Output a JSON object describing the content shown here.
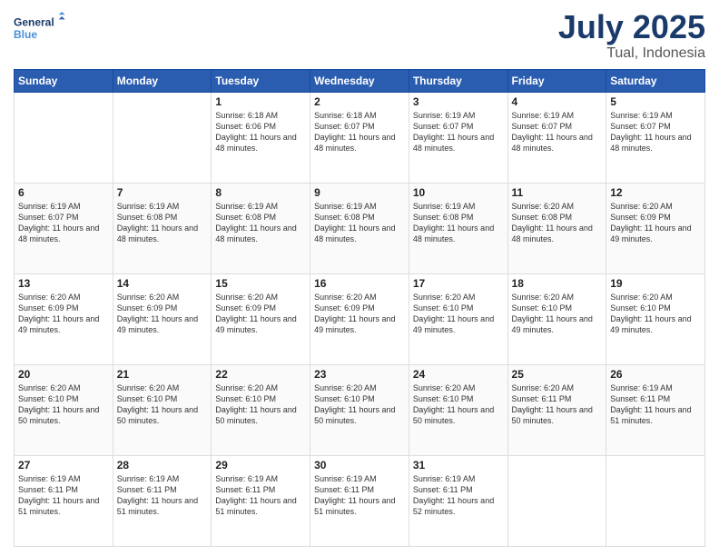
{
  "header": {
    "logo_line1": "General",
    "logo_line2": "Blue",
    "month": "July 2025",
    "location": "Tual, Indonesia"
  },
  "days_of_week": [
    "Sunday",
    "Monday",
    "Tuesday",
    "Wednesday",
    "Thursday",
    "Friday",
    "Saturday"
  ],
  "weeks": [
    [
      {
        "day": "",
        "info": ""
      },
      {
        "day": "",
        "info": ""
      },
      {
        "day": "1",
        "info": "Sunrise: 6:18 AM\nSunset: 6:06 PM\nDaylight: 11 hours and 48 minutes."
      },
      {
        "day": "2",
        "info": "Sunrise: 6:18 AM\nSunset: 6:07 PM\nDaylight: 11 hours and 48 minutes."
      },
      {
        "day": "3",
        "info": "Sunrise: 6:19 AM\nSunset: 6:07 PM\nDaylight: 11 hours and 48 minutes."
      },
      {
        "day": "4",
        "info": "Sunrise: 6:19 AM\nSunset: 6:07 PM\nDaylight: 11 hours and 48 minutes."
      },
      {
        "day": "5",
        "info": "Sunrise: 6:19 AM\nSunset: 6:07 PM\nDaylight: 11 hours and 48 minutes."
      }
    ],
    [
      {
        "day": "6",
        "info": "Sunrise: 6:19 AM\nSunset: 6:07 PM\nDaylight: 11 hours and 48 minutes."
      },
      {
        "day": "7",
        "info": "Sunrise: 6:19 AM\nSunset: 6:08 PM\nDaylight: 11 hours and 48 minutes."
      },
      {
        "day": "8",
        "info": "Sunrise: 6:19 AM\nSunset: 6:08 PM\nDaylight: 11 hours and 48 minutes."
      },
      {
        "day": "9",
        "info": "Sunrise: 6:19 AM\nSunset: 6:08 PM\nDaylight: 11 hours and 48 minutes."
      },
      {
        "day": "10",
        "info": "Sunrise: 6:19 AM\nSunset: 6:08 PM\nDaylight: 11 hours and 48 minutes."
      },
      {
        "day": "11",
        "info": "Sunrise: 6:20 AM\nSunset: 6:08 PM\nDaylight: 11 hours and 48 minutes."
      },
      {
        "day": "12",
        "info": "Sunrise: 6:20 AM\nSunset: 6:09 PM\nDaylight: 11 hours and 49 minutes."
      }
    ],
    [
      {
        "day": "13",
        "info": "Sunrise: 6:20 AM\nSunset: 6:09 PM\nDaylight: 11 hours and 49 minutes."
      },
      {
        "day": "14",
        "info": "Sunrise: 6:20 AM\nSunset: 6:09 PM\nDaylight: 11 hours and 49 minutes."
      },
      {
        "day": "15",
        "info": "Sunrise: 6:20 AM\nSunset: 6:09 PM\nDaylight: 11 hours and 49 minutes."
      },
      {
        "day": "16",
        "info": "Sunrise: 6:20 AM\nSunset: 6:09 PM\nDaylight: 11 hours and 49 minutes."
      },
      {
        "day": "17",
        "info": "Sunrise: 6:20 AM\nSunset: 6:10 PM\nDaylight: 11 hours and 49 minutes."
      },
      {
        "day": "18",
        "info": "Sunrise: 6:20 AM\nSunset: 6:10 PM\nDaylight: 11 hours and 49 minutes."
      },
      {
        "day": "19",
        "info": "Sunrise: 6:20 AM\nSunset: 6:10 PM\nDaylight: 11 hours and 49 minutes."
      }
    ],
    [
      {
        "day": "20",
        "info": "Sunrise: 6:20 AM\nSunset: 6:10 PM\nDaylight: 11 hours and 50 minutes."
      },
      {
        "day": "21",
        "info": "Sunrise: 6:20 AM\nSunset: 6:10 PM\nDaylight: 11 hours and 50 minutes."
      },
      {
        "day": "22",
        "info": "Sunrise: 6:20 AM\nSunset: 6:10 PM\nDaylight: 11 hours and 50 minutes."
      },
      {
        "day": "23",
        "info": "Sunrise: 6:20 AM\nSunset: 6:10 PM\nDaylight: 11 hours and 50 minutes."
      },
      {
        "day": "24",
        "info": "Sunrise: 6:20 AM\nSunset: 6:10 PM\nDaylight: 11 hours and 50 minutes."
      },
      {
        "day": "25",
        "info": "Sunrise: 6:20 AM\nSunset: 6:11 PM\nDaylight: 11 hours and 50 minutes."
      },
      {
        "day": "26",
        "info": "Sunrise: 6:19 AM\nSunset: 6:11 PM\nDaylight: 11 hours and 51 minutes."
      }
    ],
    [
      {
        "day": "27",
        "info": "Sunrise: 6:19 AM\nSunset: 6:11 PM\nDaylight: 11 hours and 51 minutes."
      },
      {
        "day": "28",
        "info": "Sunrise: 6:19 AM\nSunset: 6:11 PM\nDaylight: 11 hours and 51 minutes."
      },
      {
        "day": "29",
        "info": "Sunrise: 6:19 AM\nSunset: 6:11 PM\nDaylight: 11 hours and 51 minutes."
      },
      {
        "day": "30",
        "info": "Sunrise: 6:19 AM\nSunset: 6:11 PM\nDaylight: 11 hours and 51 minutes."
      },
      {
        "day": "31",
        "info": "Sunrise: 6:19 AM\nSunset: 6:11 PM\nDaylight: 11 hours and 52 minutes."
      },
      {
        "day": "",
        "info": ""
      },
      {
        "day": "",
        "info": ""
      }
    ]
  ]
}
